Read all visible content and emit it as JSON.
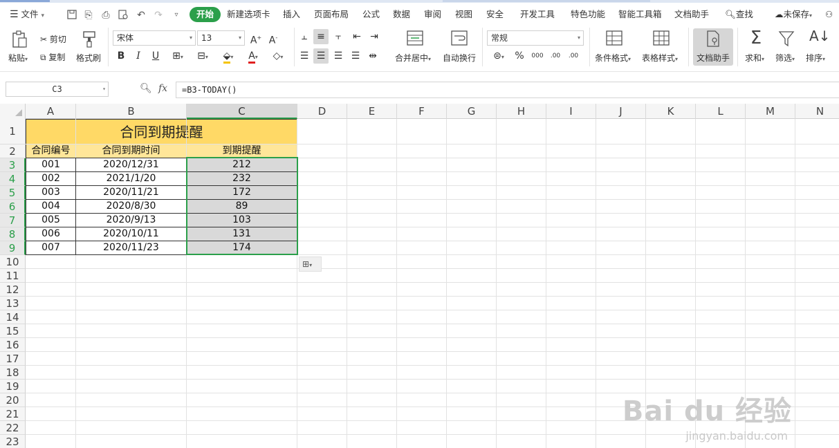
{
  "menu": {
    "file": "文件",
    "tabs": [
      "开始",
      "新建选项卡",
      "插入",
      "页面布局",
      "公式",
      "数据",
      "审阅",
      "视图",
      "安全",
      "开发工具",
      "特色功能",
      "智能工具箱",
      "文档助手"
    ],
    "active_tab": "开始",
    "search": "查找",
    "unsaved": "未保存"
  },
  "ribbon": {
    "paste": "粘贴",
    "cut": "剪切",
    "copy": "复制",
    "format_painter": "格式刷",
    "font_name": "宋体",
    "font_size": "13",
    "merge_center": "合并居中",
    "wrap_text": "自动换行",
    "number_format": "常规",
    "conditional_format": "条件格式",
    "table_style": "表格样式",
    "doc_assistant": "文档助手",
    "sum": "求和",
    "filter": "筛选",
    "sort": "排序"
  },
  "formula_bar": {
    "name_box": "C3",
    "fx_label": "fx",
    "formula": "=B3-TODAY()"
  },
  "columns": [
    "A",
    "B",
    "C",
    "D",
    "E",
    "F",
    "G",
    "H",
    "I",
    "J",
    "K",
    "L",
    "M",
    "N"
  ],
  "selected_column": "C",
  "rows": [
    "1",
    "2",
    "3",
    "4",
    "5",
    "6",
    "7",
    "8",
    "9",
    "10",
    "11",
    "12",
    "13",
    "14",
    "15",
    "16",
    "17",
    "18",
    "19",
    "20",
    "21",
    "22",
    "23"
  ],
  "sheet": {
    "title": "合同到期提醒",
    "headers": [
      "合同编号",
      "合同到期时间",
      "到期提醒"
    ],
    "data": [
      [
        "001",
        "2020/12/31",
        "212"
      ],
      [
        "002",
        "2021/1/20",
        "232"
      ],
      [
        "003",
        "2020/11/21",
        "172"
      ],
      [
        "004",
        "2020/8/30",
        "89"
      ],
      [
        "005",
        "2020/9/13",
        "103"
      ],
      [
        "006",
        "2020/10/11",
        "131"
      ],
      [
        "007",
        "2020/11/23",
        "174"
      ]
    ]
  },
  "watermark": {
    "logo": "Bai du 经验",
    "url": "jingyan.baidu.com"
  }
}
